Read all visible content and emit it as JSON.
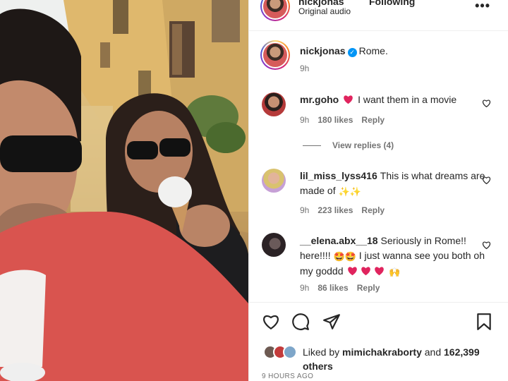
{
  "header": {
    "username": "nickjonas",
    "follow_status": "Following",
    "audio": "Original audio",
    "more_icon": "more-horizontal-icon"
  },
  "caption": {
    "username": "nickjonas",
    "text": "Rome.",
    "time": "9h"
  },
  "comments": [
    {
      "username": "mr.goho",
      "text": "I want them in a movie",
      "time": "9h",
      "likes": "180 likes",
      "reply": "Reply"
    },
    {
      "username": "lil_miss_lyss416",
      "text": "This is what dreams are made of",
      "time": "9h",
      "likes": "223 likes",
      "reply": "Reply"
    },
    {
      "username": "__elena.abx__18",
      "text_1": "Seriously in Rome!! here!!!!",
      "text_2": "I just wanna see you both oh my goddd",
      "time": "9h",
      "likes": "86 likes",
      "reply": "Reply"
    }
  ],
  "view_replies": "View replies (4)",
  "actions": {
    "icons": [
      "heart-outline-icon",
      "comment-icon",
      "share-icon",
      "bookmark-icon"
    ]
  },
  "likes_summary": {
    "prefix": "Liked by",
    "user": "mimichakraborty",
    "suffix": "and",
    "count": "162,399",
    "others": "others"
  },
  "posted_ago": "9 HOURS AGO",
  "colors": {
    "verified": "#0095f6",
    "heart_red": "#ed4956",
    "secondary_text": "#737373"
  }
}
